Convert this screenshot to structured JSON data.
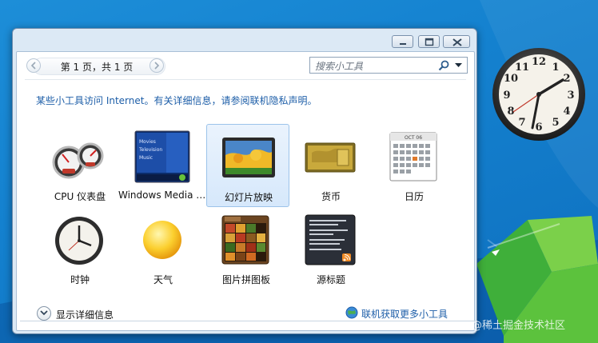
{
  "window": {
    "pager": {
      "label": "第 1 页，共 1 页"
    },
    "search": {
      "placeholder": "搜索小工具"
    },
    "info_link": "某些小工具访问 Internet。有关详细信息，请参阅联机隐私声明。",
    "gadgets": [
      {
        "label": "CPU 仪表盘",
        "icon": "cpu-meter-icon",
        "selected": false
      },
      {
        "label": "Windows Media Center",
        "icon": "media-center-icon",
        "selected": false
      },
      {
        "label": "幻灯片放映",
        "icon": "slideshow-icon",
        "selected": true
      },
      {
        "label": "货币",
        "icon": "currency-icon",
        "selected": false
      },
      {
        "label": "日历",
        "icon": "calendar-icon",
        "selected": false
      },
      {
        "label": "时钟",
        "icon": "clock-icon",
        "selected": false
      },
      {
        "label": "天气",
        "icon": "weather-sun-icon",
        "selected": false
      },
      {
        "label": "图片拼图板",
        "icon": "picture-puzzle-icon",
        "selected": false
      },
      {
        "label": "源标题",
        "icon": "feed-headlines-icon",
        "selected": false
      }
    ],
    "media_center_thumb": [
      "Movies",
      "Television",
      "Music"
    ],
    "calendar_thumb": "OCT 06",
    "footer": {
      "details_label": "显示详细信息",
      "online_label": "联机获取更多小工具"
    }
  },
  "desktop": {
    "clock_numbers": [
      "12",
      "1",
      "2",
      "3",
      "4",
      "5",
      "6",
      "7",
      "8",
      "9",
      "10",
      "11"
    ],
    "watermark": "@稀土掘金技术社区"
  },
  "colors": {
    "link": "#1d5ea8",
    "selection_bg": "#d6e8fb",
    "desktop": "#1481cf"
  }
}
